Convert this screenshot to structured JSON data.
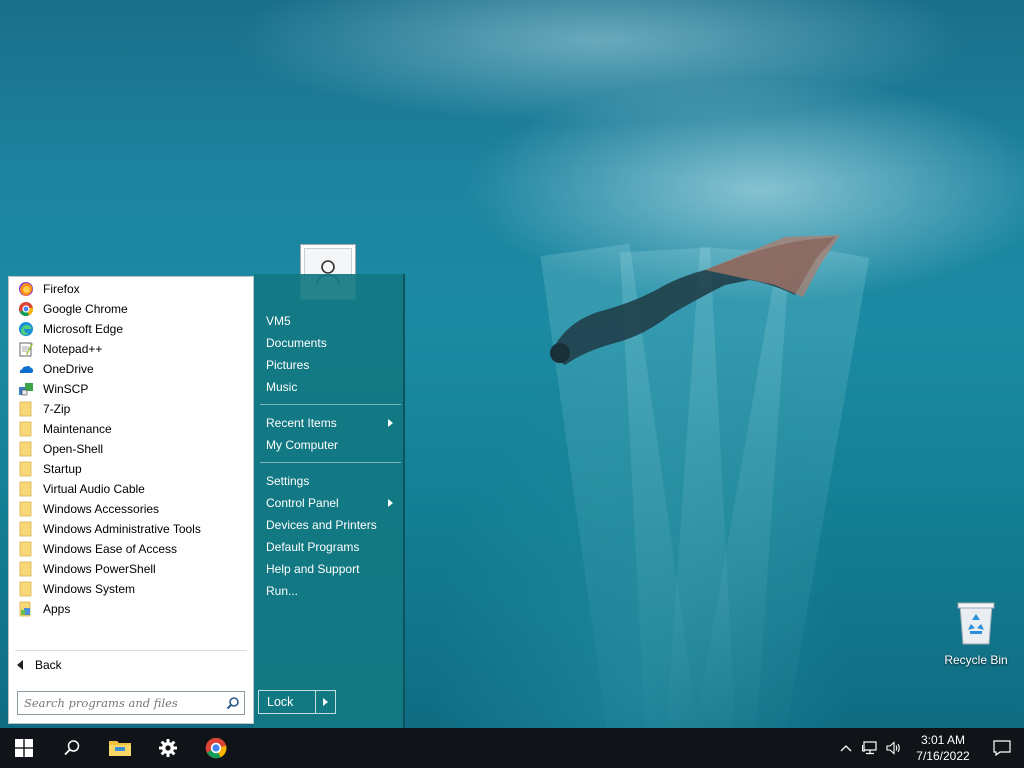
{
  "desktop": {
    "recycle_bin_label": "Recycle Bin"
  },
  "start_menu": {
    "programs": [
      {
        "label": "Firefox",
        "icon": "firefox-icon"
      },
      {
        "label": "Google Chrome",
        "icon": "chrome-icon"
      },
      {
        "label": "Microsoft Edge",
        "icon": "edge-icon"
      },
      {
        "label": "Notepad++",
        "icon": "notepadpp-icon"
      },
      {
        "label": "OneDrive",
        "icon": "onedrive-icon"
      },
      {
        "label": "WinSCP",
        "icon": "winscp-icon"
      },
      {
        "label": "7-Zip",
        "icon": "folder-icon"
      },
      {
        "label": "Maintenance",
        "icon": "folder-icon"
      },
      {
        "label": "Open-Shell",
        "icon": "folder-icon"
      },
      {
        "label": "Startup",
        "icon": "folder-icon"
      },
      {
        "label": "Virtual Audio Cable",
        "icon": "folder-icon"
      },
      {
        "label": "Windows Accessories",
        "icon": "folder-icon"
      },
      {
        "label": "Windows Administrative Tools",
        "icon": "folder-icon"
      },
      {
        "label": "Windows Ease of Access",
        "icon": "folder-icon"
      },
      {
        "label": "Windows PowerShell",
        "icon": "folder-icon"
      },
      {
        "label": "Windows System",
        "icon": "folder-icon"
      },
      {
        "label": "Apps",
        "icon": "apps-icon"
      }
    ],
    "back_label": "Back",
    "search_placeholder": "Search programs and files",
    "right_items": {
      "user": "VM5",
      "documents": "Documents",
      "pictures": "Pictures",
      "music": "Music",
      "recent_items": "Recent Items",
      "my_computer": "My Computer",
      "settings": "Settings",
      "control_panel": "Control Panel",
      "devices_printers": "Devices and Printers",
      "default_programs": "Default Programs",
      "help_support": "Help and Support",
      "run": "Run..."
    },
    "lock_label": "Lock"
  },
  "taskbar": {
    "clock_time": "3:01 AM",
    "clock_date": "7/16/2022"
  },
  "colors": {
    "menu_accent": "#12788a",
    "taskbar_bg": "#101418"
  }
}
